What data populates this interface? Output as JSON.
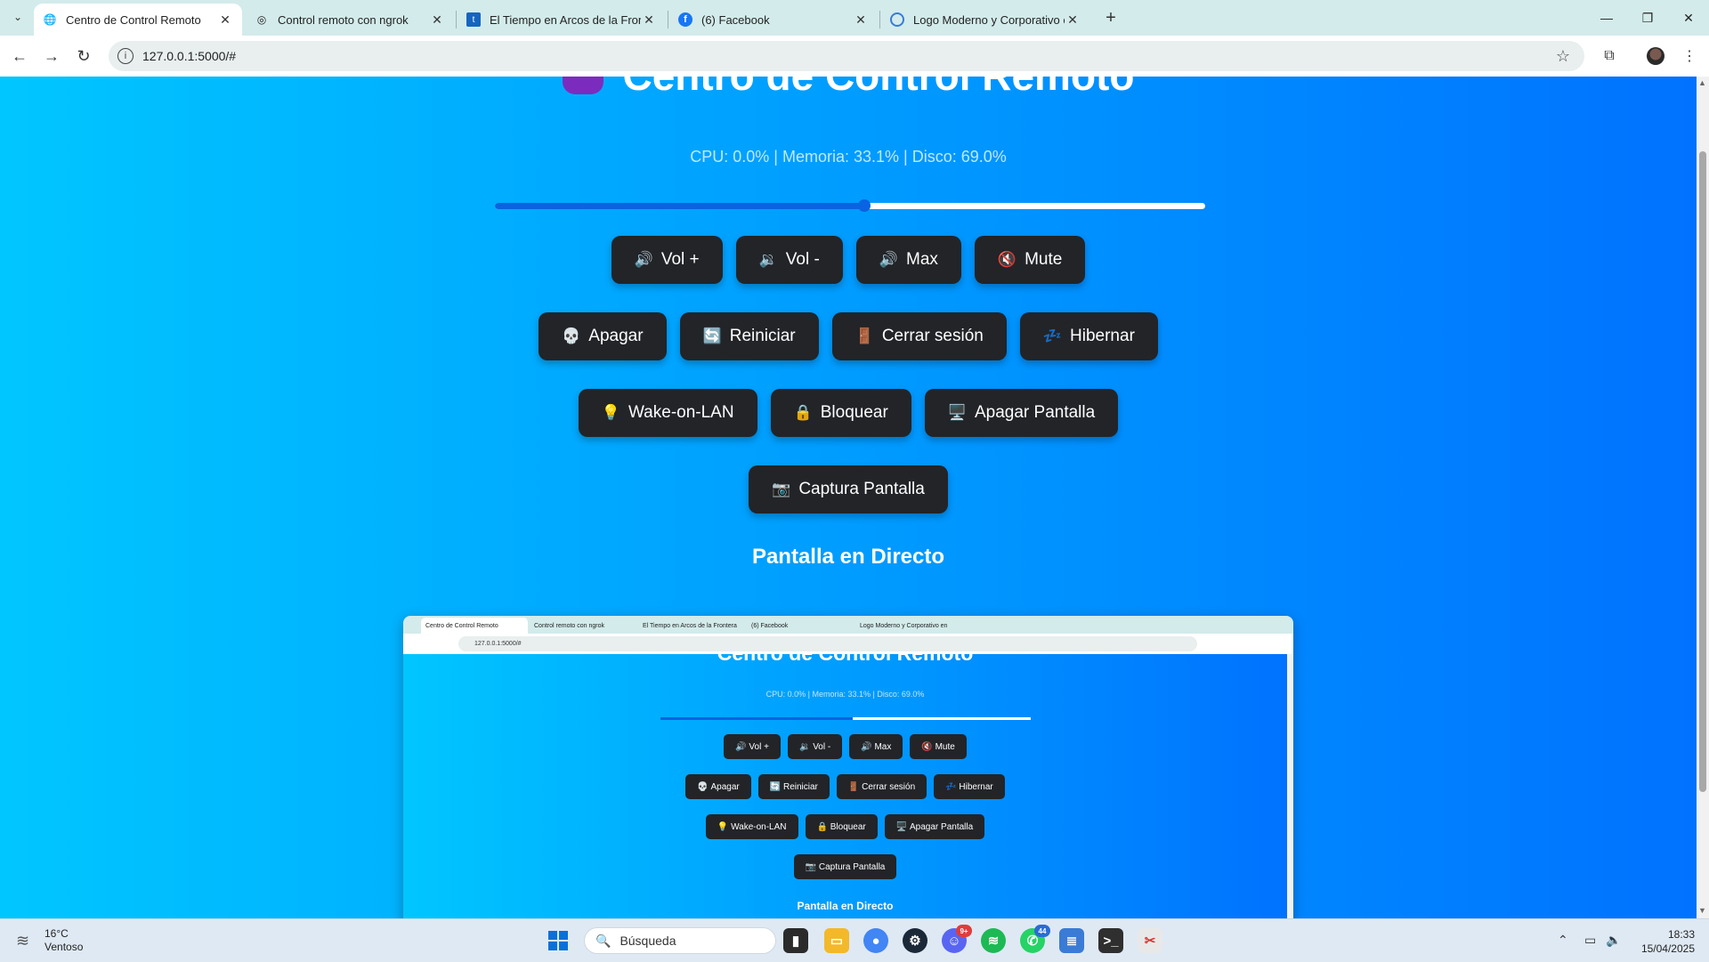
{
  "browser": {
    "tabs": [
      {
        "title": "Centro de Control Remoto",
        "active": true,
        "favicon": "globe-icon"
      },
      {
        "title": "Control remoto con ngrok",
        "active": false,
        "favicon": "openai-icon"
      },
      {
        "title": "El Tiempo en Arcos de la Frontera",
        "active": false,
        "favicon": "weather-icon"
      },
      {
        "title": "(6) Facebook",
        "active": false,
        "favicon": "facebook-icon"
      },
      {
        "title": "Logo Moderno y Corporativo en",
        "active": false,
        "favicon": "logo-icon"
      }
    ],
    "url": "127.0.0.1:5000/#"
  },
  "page": {
    "title": "Centro de Control Remoto",
    "stats": "CPU: 0.0% | Memoria: 33.1% | Disco: 69.0%",
    "volume_level": 0.52,
    "button_rows": [
      [
        {
          "icon": "🔊",
          "label": "Vol +"
        },
        {
          "icon": "🔉",
          "label": "Vol -"
        },
        {
          "icon": "🔊",
          "label": "Max"
        },
        {
          "icon": "🔇",
          "label": "Mute"
        }
      ],
      [
        {
          "icon": "💀",
          "label": "Apagar"
        },
        {
          "icon": "🔄",
          "label": "Reiniciar"
        },
        {
          "icon": "🚪",
          "label": "Cerrar sesión"
        },
        {
          "icon": "💤",
          "label": "Hibernar"
        }
      ],
      [
        {
          "icon": "💡",
          "label": "Wake-on-LAN"
        },
        {
          "icon": "🔒",
          "label": "Bloquear"
        },
        {
          "icon": "🖥️",
          "label": "Apagar Pantalla"
        }
      ],
      [
        {
          "icon": "📷",
          "label": "Captura Pantalla"
        }
      ]
    ],
    "live_section_title": "Pantalla en Directo"
  },
  "taskbar": {
    "weather_temp": "16°C",
    "weather_desc": "Ventoso",
    "search_placeholder": "Búsqueda",
    "chrome_badge": "",
    "discord_badge": "9+",
    "whatsapp_badge": "44",
    "time": "18:33",
    "date": "15/04/2025"
  },
  "colors": {
    "gradient_start": "#00c6ff",
    "gradient_end": "#0072ff",
    "button_bg": "#222428",
    "slider_fill": "#0a63e0"
  }
}
